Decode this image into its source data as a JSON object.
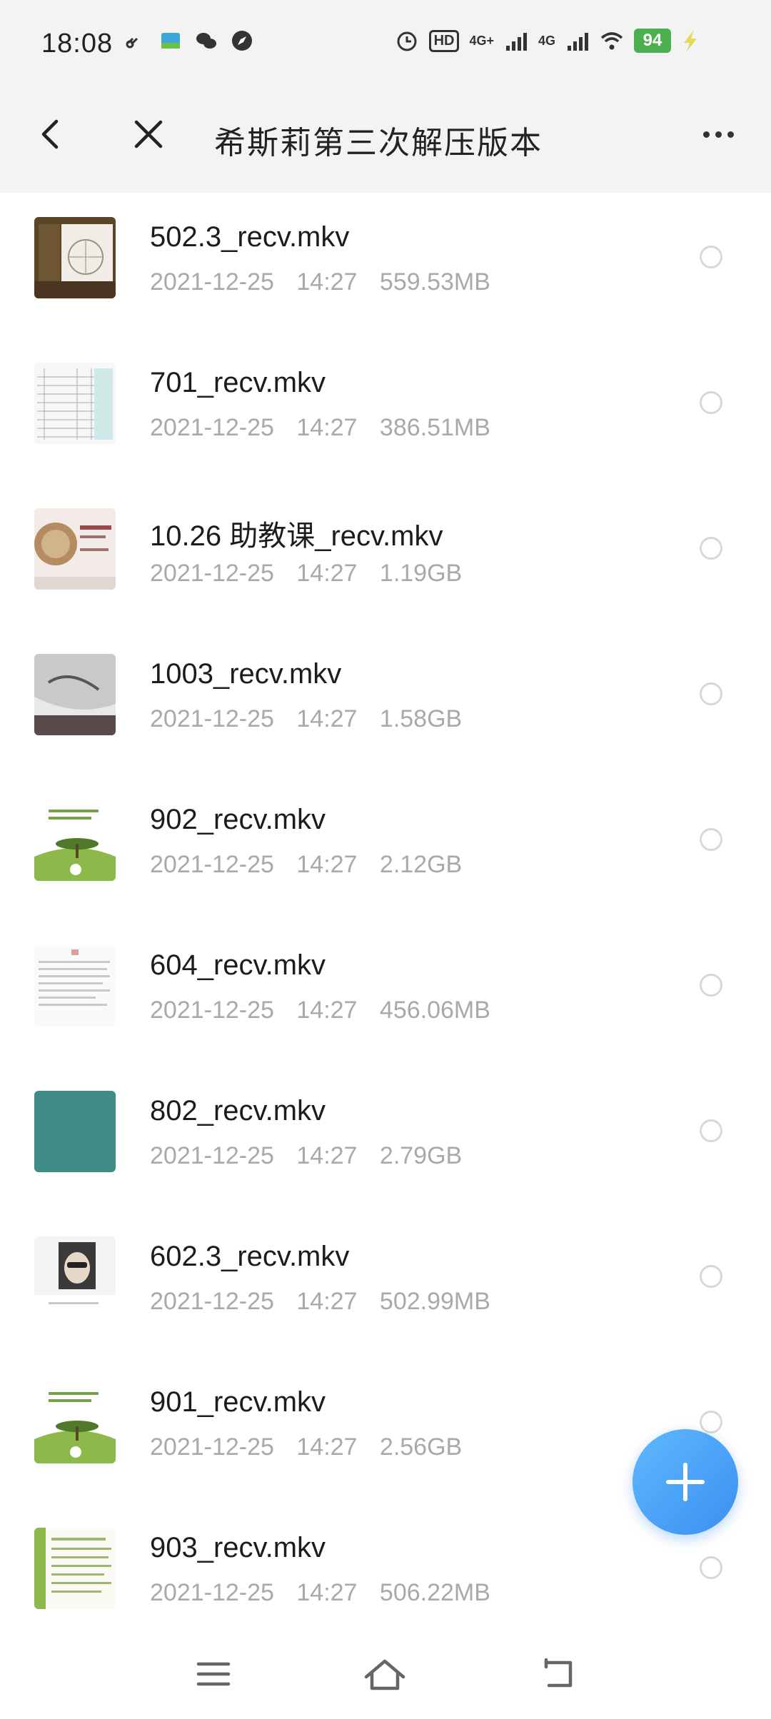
{
  "status_bar": {
    "time": "18:08",
    "signal1_label": "4G+",
    "signal2_label": "4G",
    "hd_label": "HD",
    "battery": "94"
  },
  "header": {
    "title": "希斯莉第三次解压版本"
  },
  "files": [
    {
      "name": "502.3_recv.mkv",
      "date": "2021-12-25",
      "time": "14:27",
      "size": "559.53MB",
      "thumb": "brown-diagram"
    },
    {
      "name": "701_recv.mkv",
      "date": "2021-12-25",
      "time": "14:27",
      "size": "386.51MB",
      "thumb": "table-sheet"
    },
    {
      "name": "10.26 助教课_recv.mkv",
      "date": "2021-12-25",
      "time": "14:27",
      "size": "1.19GB",
      "thumb": "map-slide"
    },
    {
      "name": "1003_recv.mkv",
      "date": "2021-12-25",
      "time": "14:27",
      "size": "1.58GB",
      "thumb": "dark-photo"
    },
    {
      "name": "902_recv.mkv",
      "date": "2021-12-25",
      "time": "14:27",
      "size": "2.12GB",
      "thumb": "green-tree"
    },
    {
      "name": "604_recv.mkv",
      "date": "2021-12-25",
      "time": "14:27",
      "size": "456.06MB",
      "thumb": "text-page"
    },
    {
      "name": "802_recv.mkv",
      "date": "2021-12-25",
      "time": "14:27",
      "size": "2.79GB",
      "thumb": "teal-solid"
    },
    {
      "name": "602.3_recv.mkv",
      "date": "2021-12-25",
      "time": "14:27",
      "size": "502.99MB",
      "thumb": "portrait"
    },
    {
      "name": "901_recv.mkv",
      "date": "2021-12-25",
      "time": "14:27",
      "size": "2.56GB",
      "thumb": "green-tree"
    },
    {
      "name": "903_recv.mkv",
      "date": "2021-12-25",
      "time": "14:27",
      "size": "506.22MB",
      "thumb": "green-list"
    }
  ],
  "fab": {
    "icon": "plus-icon"
  },
  "colors": {
    "accent": "#3b8ff0",
    "header_bg": "#f3f3f3",
    "meta_text": "#a9a9a9",
    "battery": "#4caf50"
  }
}
